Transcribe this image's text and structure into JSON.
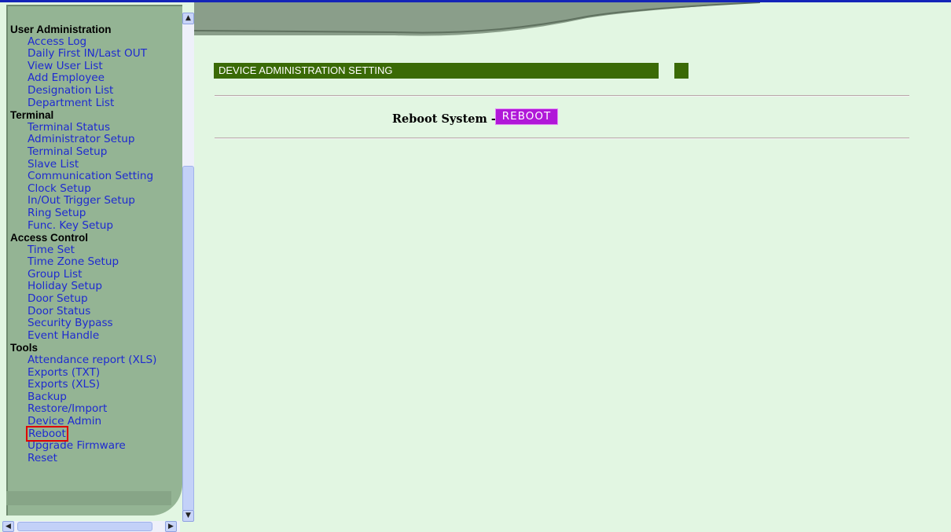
{
  "sidebar": {
    "sections": [
      {
        "title": "User Administration",
        "items": [
          "Access Log",
          "Daily First IN/Last OUT",
          "View User List",
          "Add Employee",
          "Designation List",
          "Department List"
        ]
      },
      {
        "title": "Terminal",
        "items": [
          "Terminal Status",
          "Administrator Setup",
          "Terminal Setup",
          "Slave List",
          "Communication Setting",
          "Clock Setup",
          "In/Out Trigger Setup",
          "Ring Setup",
          "Func. Key Setup"
        ]
      },
      {
        "title": "Access Control",
        "items": [
          "Time Set",
          "Time Zone Setup",
          "Group List",
          "Holiday Setup",
          "Door Setup",
          "Door Status",
          "Security Bypass",
          "Event Handle"
        ]
      },
      {
        "title": "Tools",
        "items": [
          "Attendance report (XLS)",
          "Exports (TXT)",
          "Exports (XLS)",
          "Backup",
          "Restore/Import",
          "Device Admin",
          "Reboot",
          "Upgrade Firmware",
          "Reset"
        ]
      }
    ],
    "active_item": "Reboot"
  },
  "main": {
    "title": "DEVICE ADMINISTRATION SETTING",
    "reboot_label": "Reboot System -",
    "reboot_button": "REBOOT"
  },
  "colors": {
    "page_background": "#e2f6e2",
    "sidebar_panel": "#94b494",
    "title_bar": "#3a6a06",
    "reboot_button": "#b018d8",
    "link": "#1e2ad0",
    "active_outline": "#e00000"
  },
  "icons": {
    "scroll_up": "arrow-up-icon",
    "scroll_down": "arrow-down-icon",
    "scroll_left": "arrow-left-icon",
    "scroll_right": "arrow-right-icon"
  }
}
